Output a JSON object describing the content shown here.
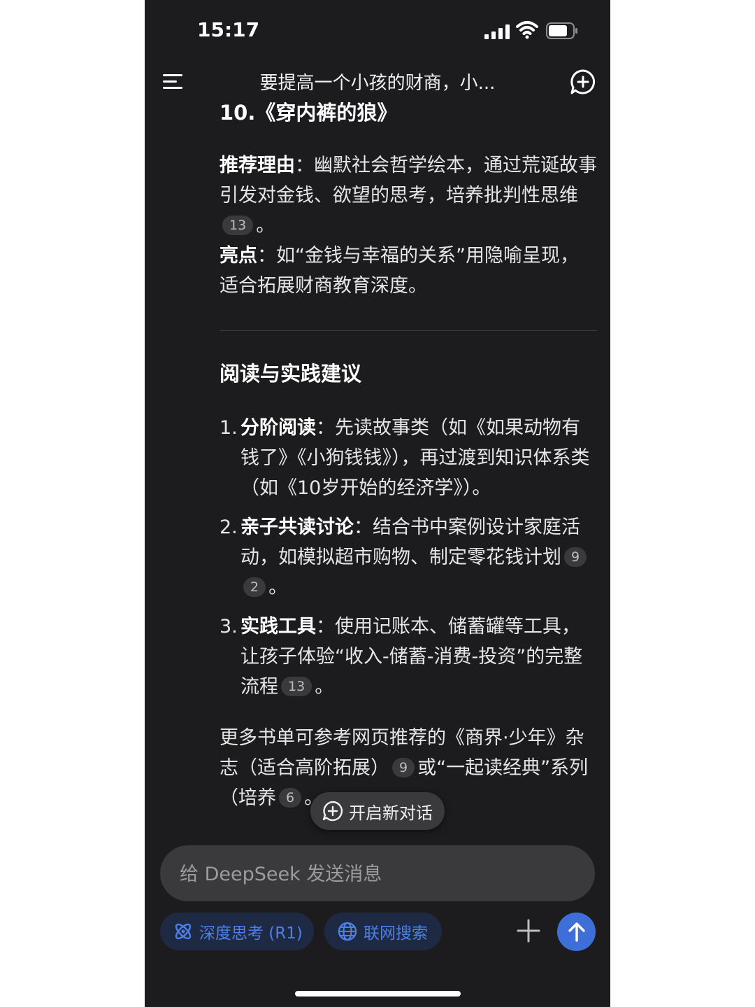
{
  "status_bar": {
    "time": "15:17"
  },
  "header": {
    "title": "要提高一个小孩的财商，小..."
  },
  "content": {
    "book_title": "10.《穿内裤的狼》",
    "reason_label": "推荐理由",
    "reason_colon": "：",
    "reason_text": "幽默社会哲学绘本，通过荒诞故事引发对金钱、欲望的思考，培养批判性思维",
    "reason_badge": "13",
    "reason_end": "。",
    "highlight_label": "亮点",
    "highlight_colon": "：",
    "highlight_text": "如“金钱与幸福的关系”用隐喻呈现，适合拓展财商教育深度。",
    "section_title": "阅读与实践建议",
    "suggestions": [
      {
        "num": "1.",
        "label": "分阶阅读",
        "colon": "：",
        "text": "先读故事类（如《如果动物有钱了》《小狗钱钱》），再过渡到知识体系类（如《10岁开始的经济学》）。"
      },
      {
        "num": "2.",
        "label": "亲子共读讨论",
        "colon": "：",
        "text": "结合书中案例设计家庭活动，如模拟超市购物、制定零花钱计划",
        "badges": [
          "9",
          "2"
        ],
        "end": "。"
      },
      {
        "num": "3.",
        "label": "实践工具",
        "colon": "：",
        "text": "使用记账本、储蓄罐等工具，让孩子体验“收入-储蓄-消费-投资”的完整流程",
        "badges": [
          "13"
        ],
        "end": "。"
      }
    ],
    "footnote_part1": "更多书单可参考网页推荐的《商界·少年》杂志（适合高阶拓展）",
    "footnote_badge1": "9",
    "footnote_part2": "或“一起读经典”系列（培养",
    "footnote_badge2": "6",
    "footnote_end": "。"
  },
  "new_chat_button": {
    "label": "开启新对话"
  },
  "input": {
    "placeholder": "给 DeepSeek 发送消息"
  },
  "toolbar": {
    "deep_think_label": "深度思考 (R1)",
    "web_search_label": "联网搜索"
  },
  "colors": {
    "background": "#1c1c1e",
    "accent": "#4d7fe8",
    "send_button": "#3e6fd9"
  }
}
